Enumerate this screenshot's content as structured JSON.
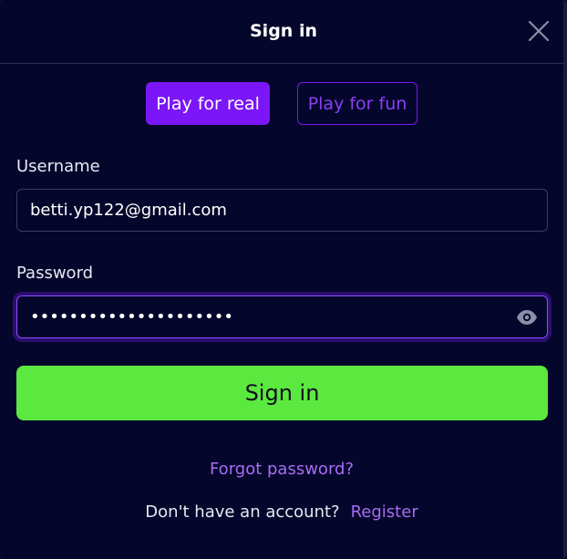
{
  "header": {
    "title": "Sign in"
  },
  "modes": {
    "real_label": "Play for real",
    "fun_label": "Play for fun"
  },
  "username": {
    "label": "Username",
    "value": "betti.yp122@gmail.com"
  },
  "password": {
    "label": "Password",
    "masked_value": "•••••••••••••••••••••"
  },
  "actions": {
    "sign_in_label": "Sign in",
    "forgot_label": "Forgot password?",
    "no_account_text": "Don't have an account?",
    "register_label": "Register"
  },
  "colors": {
    "background": "#05062b",
    "primary": "#7a16f7",
    "accent_green": "#5ce93f",
    "link": "#a86cf5"
  },
  "icons": {
    "close": "close-icon",
    "eye": "eye-icon"
  }
}
